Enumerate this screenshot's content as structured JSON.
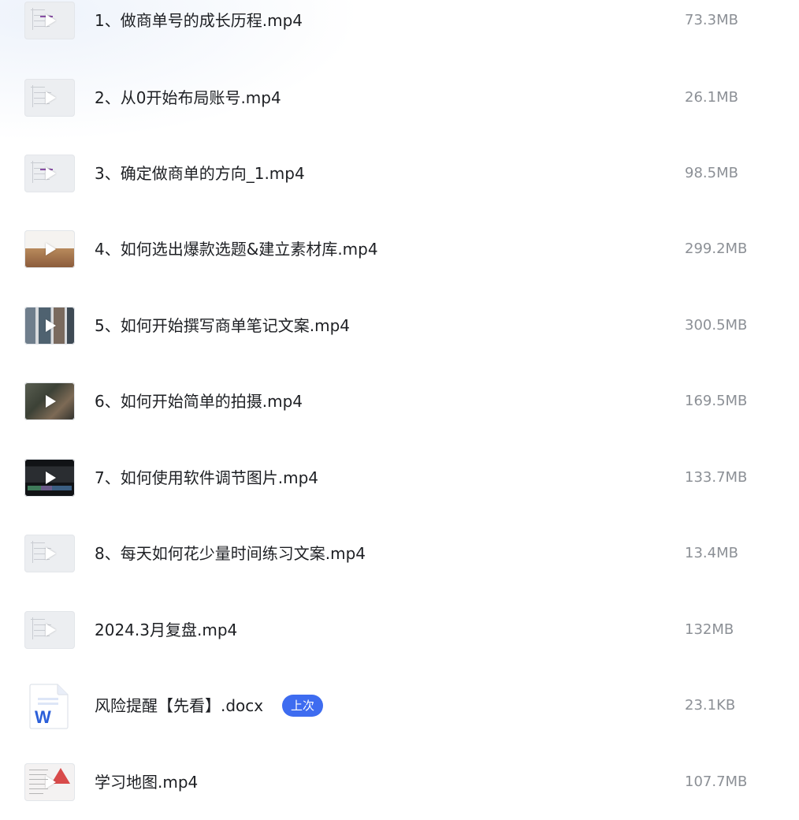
{
  "files": [
    {
      "name": "1、做商单号的成长历程.mp4",
      "size": "73.3MB",
      "type": "video"
    },
    {
      "name": "2、从0开始布局账号.mp4",
      "size": "26.1MB",
      "type": "video"
    },
    {
      "name": "3、确定做商单的方向_1.mp4",
      "size": "98.5MB",
      "type": "video"
    },
    {
      "name": "4、如何选出爆款选题&建立素材库.mp4",
      "size": "299.2MB",
      "type": "video"
    },
    {
      "name": "5、如何开始撰写商单笔记文案.mp4",
      "size": "300.5MB",
      "type": "video"
    },
    {
      "name": "6、如何开始简单的拍摄.mp4",
      "size": "169.5MB",
      "type": "video"
    },
    {
      "name": "7、如何使用软件调节图片.mp4",
      "size": "133.7MB",
      "type": "video"
    },
    {
      "name": "8、每天如何花少量时间练习文案.mp4",
      "size": "13.4MB",
      "type": "video"
    },
    {
      "name": "2024.3月复盘.mp4",
      "size": "132MB",
      "type": "video"
    },
    {
      "name": "风险提醒【先看】.docx",
      "size": "23.1KB",
      "type": "doc",
      "badge": "上次"
    },
    {
      "name": "学习地图.mp4",
      "size": "107.7MB",
      "type": "video"
    }
  ],
  "icons": {
    "video": "play-icon",
    "doc": "word-doc-icon"
  },
  "colors": {
    "badge": "#3e6cf0",
    "word_blue": "#2b5fd9"
  }
}
